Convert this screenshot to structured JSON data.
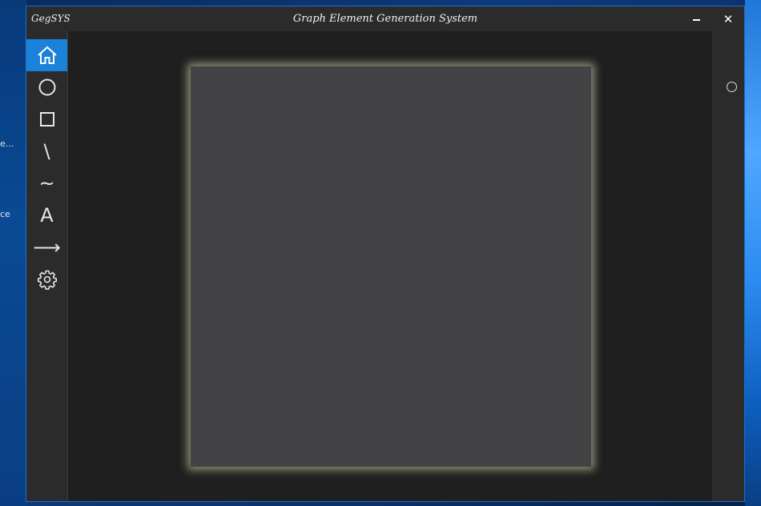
{
  "desktop": {
    "labels": [
      "e...",
      "ce"
    ]
  },
  "window": {
    "app_name": "GegSYS",
    "title": "Graph Element Generation System",
    "minimize_glyph": "—",
    "close_glyph": "✕"
  },
  "sidebar": {
    "tools": [
      {
        "name": "home-icon",
        "glyph": "",
        "active": true
      },
      {
        "name": "circle-icon",
        "glyph": ""
      },
      {
        "name": "rectangle-icon",
        "glyph": ""
      },
      {
        "name": "line-icon",
        "glyph": "\\"
      },
      {
        "name": "curve-icon",
        "glyph": "~"
      },
      {
        "name": "text-icon",
        "glyph": "A"
      },
      {
        "name": "arrow-icon",
        "glyph": "⟶"
      },
      {
        "name": "settings-icon",
        "glyph": ""
      }
    ]
  },
  "colors": {
    "accent": "#1b82d9",
    "canvas": "#434345",
    "canvas_glow": "#e8e8be"
  }
}
